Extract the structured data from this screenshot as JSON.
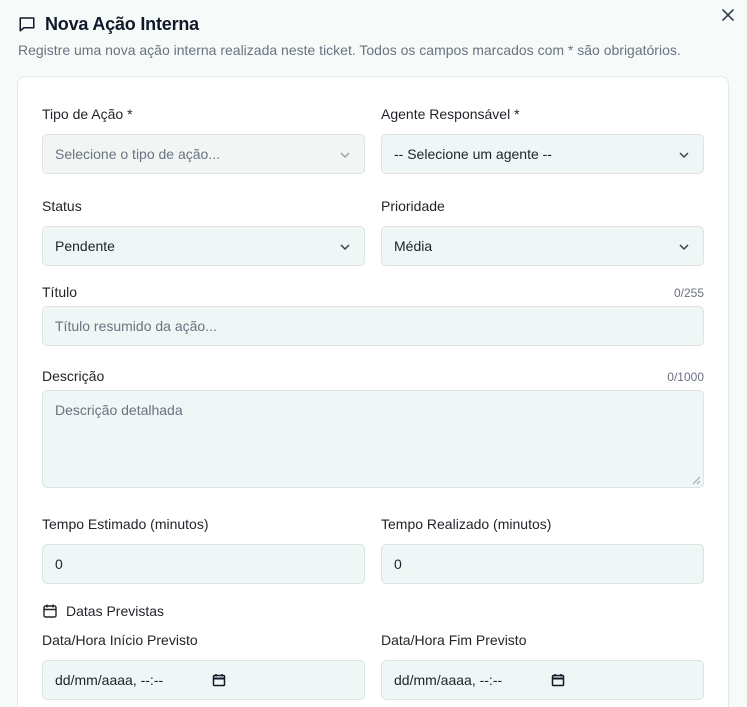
{
  "header": {
    "title": "Nova Ação Interna",
    "subtitle": "Registre uma nova ação interna realizada neste ticket. Todos os campos marcados com * são obrigatórios."
  },
  "fields": {
    "tipo_acao": {
      "label": "Tipo de Ação *",
      "placeholder": "Selecione o tipo de ação..."
    },
    "agente": {
      "label": "Agente Responsável *",
      "value": "-- Selecione um agente --"
    },
    "status": {
      "label": "Status",
      "value": "Pendente"
    },
    "prioridade": {
      "label": "Prioridade",
      "value": "Média"
    },
    "titulo": {
      "label": "Título",
      "counter": "0/255",
      "placeholder": "Título resumido da ação..."
    },
    "descricao": {
      "label": "Descrição",
      "counter": "0/1000",
      "placeholder": "Descrição detalhada"
    },
    "tempo_estimado": {
      "label": "Tempo Estimado (minutos)",
      "value": "0"
    },
    "tempo_realizado": {
      "label": "Tempo Realizado (minutos)",
      "value": "0"
    },
    "datas_section": "Datas Previstas",
    "inicio_previsto": {
      "label": "Data/Hora Início Previsto",
      "value": "dd/mm/aaaa, --:--"
    },
    "fim_previsto": {
      "label": "Data/Hora Fim Previsto",
      "value": "dd/mm/aaaa, --:--"
    }
  }
}
